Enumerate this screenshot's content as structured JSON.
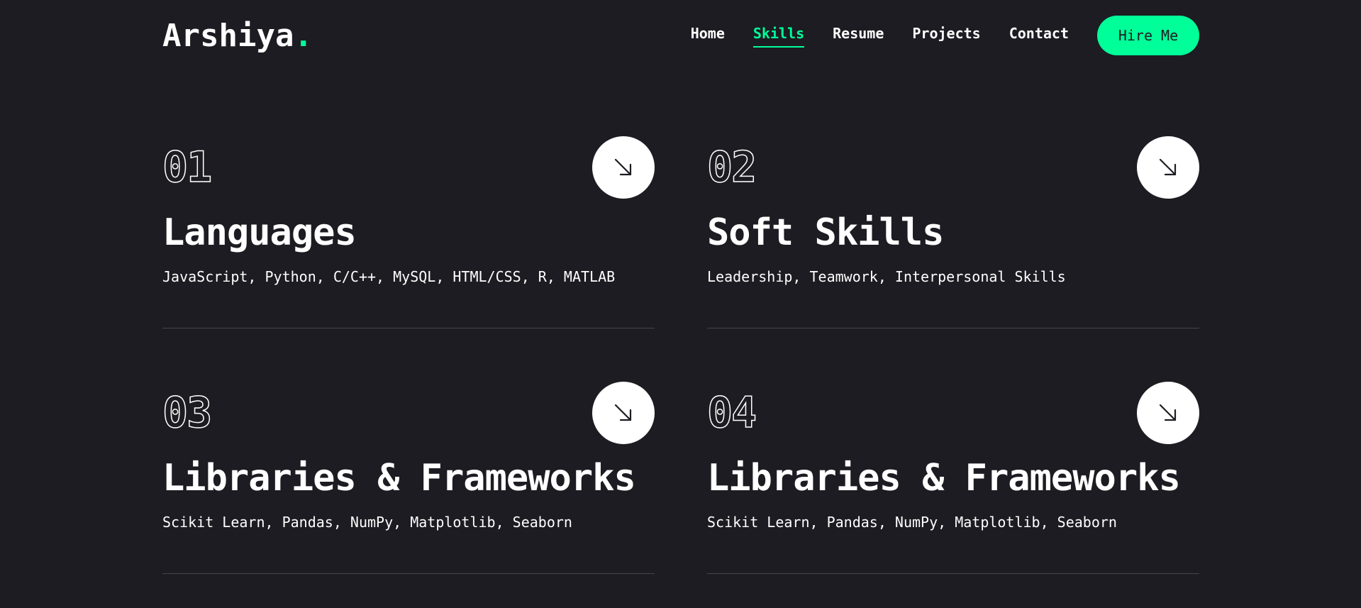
{
  "header": {
    "logo_text": "Arshiya",
    "logo_dot": ".",
    "nav": [
      {
        "label": "Home",
        "active": false
      },
      {
        "label": "Skills",
        "active": true
      },
      {
        "label": "Resume",
        "active": false
      },
      {
        "label": "Projects",
        "active": false
      },
      {
        "label": "Contact",
        "active": false
      }
    ],
    "hire_label": "Hire Me"
  },
  "cards": [
    {
      "num": "01",
      "title": "Languages",
      "desc": "JavaScript, Python, C/C++, MySQL, HTML/CSS, R, MATLAB"
    },
    {
      "num": "02",
      "title": "Soft Skills",
      "desc": "Leadership, Teamwork, Interpersonal Skills"
    },
    {
      "num": "03",
      "title": "Libraries & Frameworks",
      "desc": "Scikit Learn, Pandas, NumPy, Matplotlib, Seaborn"
    },
    {
      "num": "04",
      "title": "Libraries & Frameworks",
      "desc": "Scikit Learn, Pandas, NumPy, Matplotlib, Seaborn"
    }
  ],
  "icons": {
    "card_button": "arrow-down-right-icon"
  },
  "colors": {
    "background": "#1c1c22",
    "accent": "#00ff99",
    "text": "#ffffff"
  }
}
